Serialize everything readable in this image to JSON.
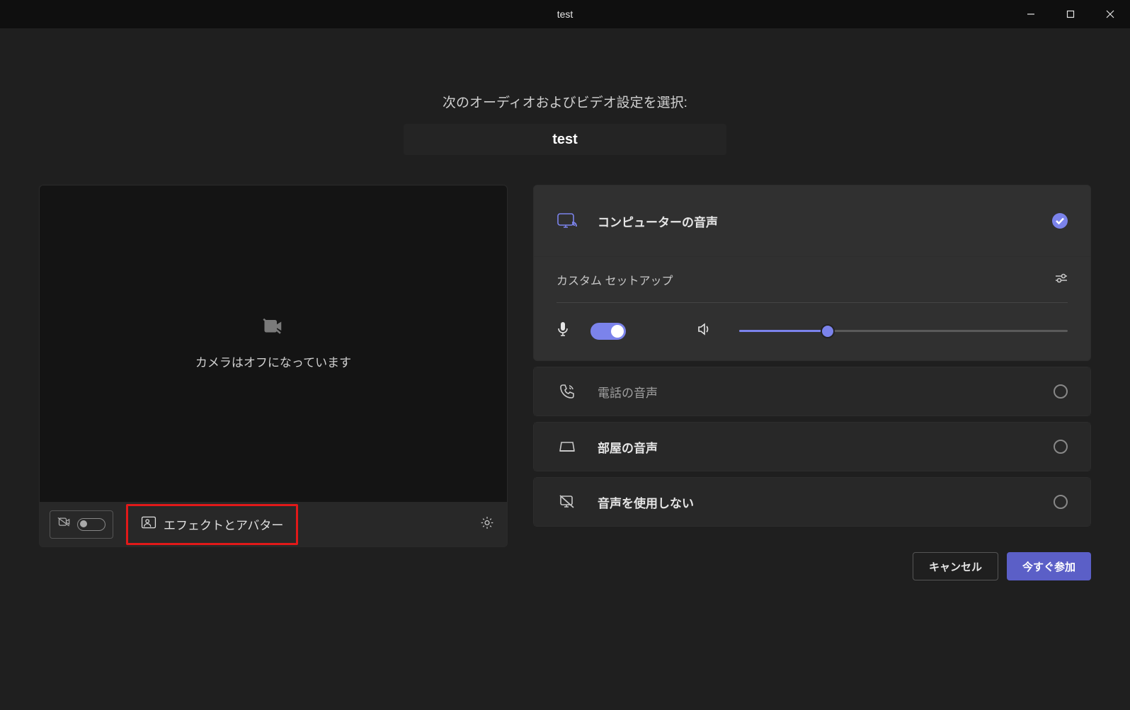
{
  "window_title": "test",
  "heading": "次のオーディオおよびビデオ設定を選択:",
  "meeting_name": "test",
  "camera_off_text": "カメラはオフになっています",
  "effects_button_label": "エフェクトとアバター",
  "audio_options": {
    "computer": "コンピューターの音声",
    "phone": "電話の音声",
    "room": "部屋の音声",
    "none": "音声を使用しない"
  },
  "custom_setup_label": "カスタム セットアップ",
  "volume_percent": 27,
  "footer": {
    "cancel": "キャンセル",
    "join": "今すぐ参加"
  }
}
